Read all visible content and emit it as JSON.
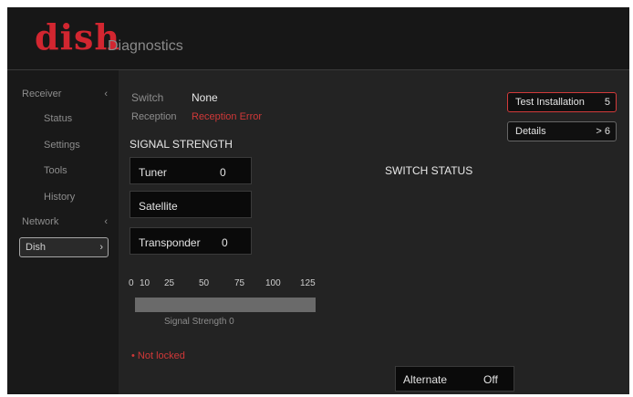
{
  "brand": {
    "logo": "dish",
    "app_title": "Diagnostics"
  },
  "sidebar": {
    "receiver": {
      "label": "Receiver",
      "arrow": "‹"
    },
    "items": [
      {
        "label": "Status"
      },
      {
        "label": "Settings"
      },
      {
        "label": "Tools"
      },
      {
        "label": "History"
      }
    ],
    "network": {
      "label": "Network",
      "arrow": "‹"
    },
    "dish": {
      "label": "Dish",
      "arrow": "›",
      "selected": true
    }
  },
  "main": {
    "switch_label": "Switch",
    "switch_value": "None",
    "reception_label": "Reception",
    "reception_value": "Reception Error",
    "signal_heading": "SIGNAL STRENGTH",
    "tuner": {
      "label": "Tuner",
      "value": "0"
    },
    "satellite": {
      "label": "Satellite",
      "value": ""
    },
    "transponder": {
      "label": "Transponder",
      "value": "0"
    },
    "scale_ticks": [
      "0",
      "10",
      "25",
      "50",
      "75",
      "100",
      "125"
    ],
    "signal_strength_text": "Signal Strength 0",
    "signal_strength_value": 0,
    "status_note": "Not locked",
    "switch_status_heading": "SWITCH STATUS",
    "alternate": {
      "label": "Alternate",
      "value": "Off"
    }
  },
  "actions": {
    "test_installation": {
      "label": "Test Installation",
      "key": "5"
    },
    "details": {
      "label": "Details",
      "key": "> 6"
    }
  },
  "colors": {
    "brand_red": "#d22630",
    "background": "#232323",
    "sidebar": "#191919",
    "panel": "#0a0a0a",
    "accent_red": "#d03838"
  },
  "icons": {
    "status_bullet": "bullet-icon",
    "nav_arrow": "chevron-icon"
  }
}
